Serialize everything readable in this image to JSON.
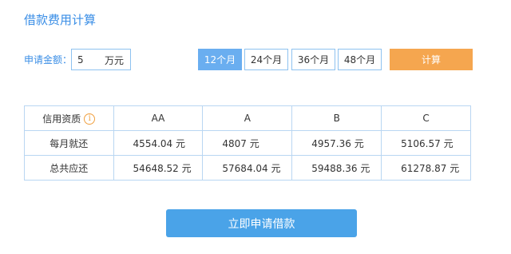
{
  "title": "借款费用计算",
  "amount": {
    "label": "申请金额：",
    "value": "5",
    "unit": "万元"
  },
  "terms": [
    {
      "label": "12个月",
      "active": true
    },
    {
      "label": "24个月",
      "active": false
    },
    {
      "label": "36个月",
      "active": false
    },
    {
      "label": "48个月",
      "active": false
    }
  ],
  "calculate_label": "计算",
  "table": {
    "header": {
      "label": "信用资质",
      "info_icon": "i",
      "grades": [
        "AA",
        "A",
        "B",
        "C"
      ]
    },
    "rows": [
      {
        "label": "每月就还",
        "values": [
          "4554.04 元",
          "4807 元",
          "4957.36 元",
          "5106.57 元"
        ]
      },
      {
        "label": "总共应还",
        "values": [
          "54648.52 元",
          "57684.04 元",
          "59488.36 元",
          "61278.87 元"
        ]
      }
    ]
  },
  "apply_label": "立即申请借款",
  "colors": {
    "accent": "#3a8ee6",
    "active_term": "#6aaef0",
    "calculate": "#f5a64f",
    "apply": "#4aa3e8",
    "border": "#b9d6f2"
  }
}
